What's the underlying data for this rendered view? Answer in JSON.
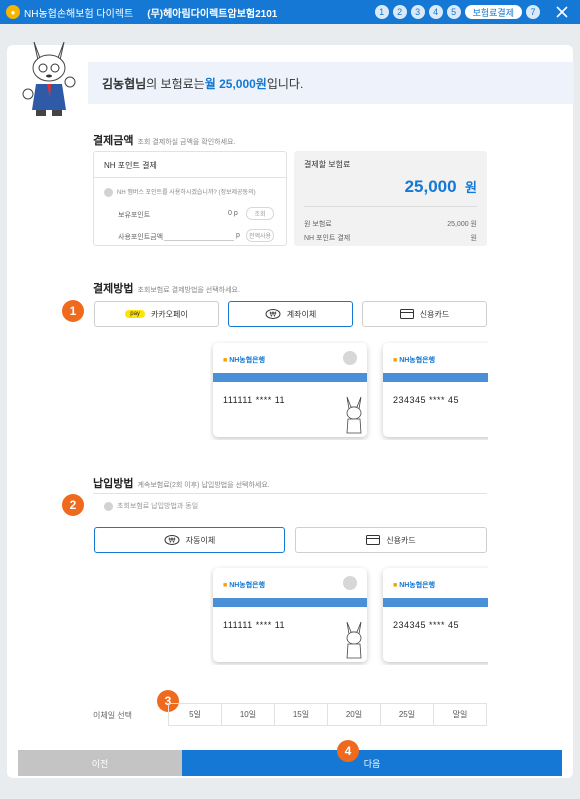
{
  "topbar": {
    "app_name": "NH농협손해보험 다이렉트",
    "product_name": "(무)헤아림다이렉트암보험2101",
    "steps": [
      "1",
      "2",
      "3",
      "4",
      "5"
    ],
    "active_step": "보험료결제",
    "last_step": "7"
  },
  "banner": {
    "name": "김농협님",
    "text_mid": "의 보험료는 ",
    "amount": "월 25,000원",
    "text_end": "입니다."
  },
  "payment_amount": {
    "title": "결제금액",
    "subtitle": "조회 결제하실 금액을 확인하세요.",
    "nh_point_title": "NH 포인트 결제",
    "nh_point_consent": "NH 멤버스 포인트를 사용하시겠습니까? (정보제공동의)",
    "held_points_label": "보유포인트",
    "held_points_value": "0 p",
    "lookup_button": "조회",
    "use_points_label": "사용포인트금액",
    "use_points_unit": "p",
    "use_all_button": "전액사용",
    "total_title": "결제할 보험료",
    "total_amount": "25,000",
    "total_unit": "원",
    "original_label": "원 보험료",
    "original_value": "25,000 원",
    "nh_pay_label": "NH 포인트 결제",
    "nh_pay_value": "원"
  },
  "payment_method": {
    "title": "결제방법",
    "subtitle": "초회보험료 결제방법을 선택하세요.",
    "options": [
      "카카오페이",
      "계좌이체",
      "신용카드"
    ],
    "kakao_badge": "pay",
    "badge": "1"
  },
  "cards_top": [
    {
      "bank": "NH농협은행",
      "number": "111111  ****  11"
    },
    {
      "bank": "NH농협은행",
      "number": "234345  ****  45"
    }
  ],
  "deposit_method": {
    "title": "납입방법",
    "subtitle": "계속보험료(2회 이후) 납입방법을 선택하세요.",
    "same_as_first": "초회보험료 납입방법과 동일",
    "options": [
      "자동이체",
      "신용카드"
    ],
    "badge": "2"
  },
  "cards_bottom": [
    {
      "bank": "NH농협은행",
      "number": "111111  ****  11"
    },
    {
      "bank": "NH농협은행",
      "number": "234345  ****  45"
    }
  ],
  "transfer_date": {
    "label": "이체일 선택",
    "dates": [
      "5일",
      "10일",
      "15일",
      "20일",
      "25일",
      "말일"
    ],
    "badge": "3"
  },
  "footer": {
    "prev": "이전",
    "next": "다음",
    "badge": "4"
  },
  "colors": {
    "brand": "#1478d4",
    "accent": "#ef6a1c"
  }
}
